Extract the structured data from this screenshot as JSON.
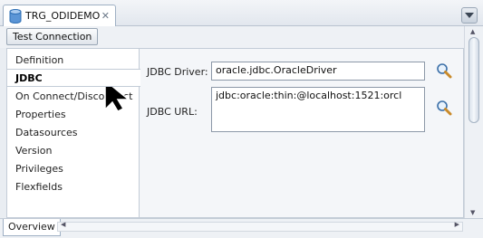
{
  "tab": {
    "title": "TRG_ODIDEMO",
    "close_glyph": "✕",
    "icon": "database-icon"
  },
  "toolbar": {
    "test_connection_label": "Test Connection"
  },
  "nav": {
    "items": [
      {
        "label": "Definition"
      },
      {
        "label": "JDBC"
      },
      {
        "label": "On Connect/Disconnect"
      },
      {
        "label": "Properties"
      },
      {
        "label": "Datasources"
      },
      {
        "label": "Version"
      },
      {
        "label": "Privileges"
      },
      {
        "label": "Flexfields"
      }
    ],
    "selected_index": 1
  },
  "form": {
    "driver_label": "JDBC Driver:",
    "driver_value": "oracle.jdbc.OracleDriver",
    "url_label": "JDBC URL:",
    "url_value": "jdbc:oracle:thin:@localhost:1521:orcl"
  },
  "bottom": {
    "overview_label": "Overview"
  },
  "colors": {
    "selected_border": "#c3ccd7",
    "accent": "#2e6fb5"
  }
}
